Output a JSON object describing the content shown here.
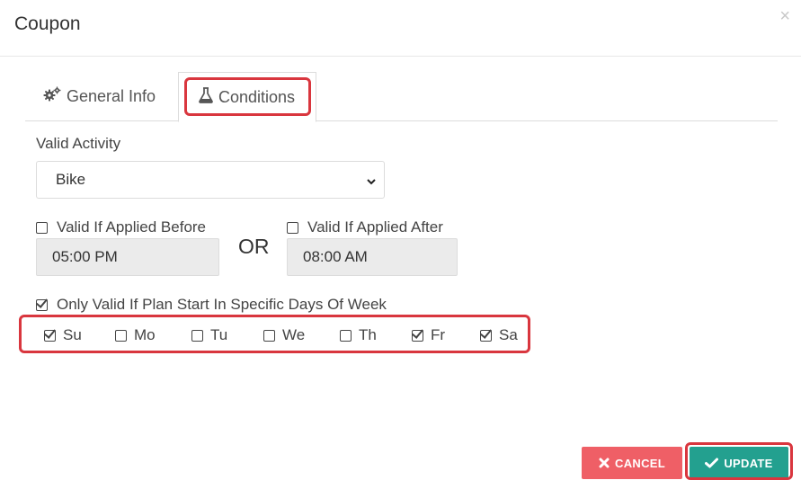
{
  "modal": {
    "title": "Coupon",
    "close_glyph": "×"
  },
  "tabs": [
    {
      "label": "General Info",
      "icon": "gears-icon",
      "active": false
    },
    {
      "label": "Conditions",
      "icon": "flask-icon",
      "active": true
    }
  ],
  "valid_activity": {
    "label": "Valid Activity",
    "selected": "Bike"
  },
  "applied_before": {
    "label": "Valid If Applied Before",
    "checked": false,
    "time": "05:00  PM"
  },
  "or_text": "OR",
  "applied_after": {
    "label": "Valid If Applied After",
    "checked": false,
    "time": "08:00  AM"
  },
  "specific_days": {
    "label": "Only Valid If Plan Start In Specific Days Of Week",
    "checked": true
  },
  "days": [
    {
      "label": "Su",
      "checked": true
    },
    {
      "label": "Mo",
      "checked": false
    },
    {
      "label": "Tu",
      "checked": false
    },
    {
      "label": "We",
      "checked": false
    },
    {
      "label": "Th",
      "checked": false
    },
    {
      "label": "Fr",
      "checked": true
    },
    {
      "label": "Sa",
      "checked": true
    }
  ],
  "buttons": {
    "cancel": "CANCEL",
    "update": "UPDATE"
  },
  "colors": {
    "highlight": "#d9363e",
    "cancel": "#ef5f66",
    "update": "#23a08f"
  }
}
